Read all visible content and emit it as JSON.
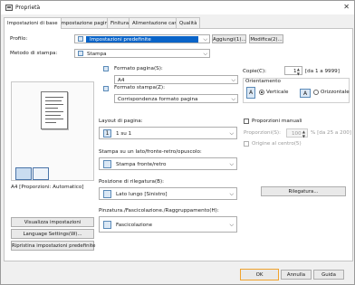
{
  "window": {
    "title": "Proprietà",
    "close_glyph": "✕"
  },
  "tabs": [
    {
      "label": "Impostazioni di base",
      "active": true
    },
    {
      "label": "Impostazione pagina"
    },
    {
      "label": "Finitura"
    },
    {
      "label": "Alimentazione carta"
    },
    {
      "label": "Qualità"
    }
  ],
  "profile": {
    "label": "Profilo:",
    "value": "Impostazioni predefinite",
    "add_label": "Aggiungi(1)...",
    "edit_label": "Modifica(2)..."
  },
  "output_method": {
    "label": "Metodo di stampa:",
    "value": "Stampa"
  },
  "paper_size": {
    "label": "Formato pagina(S):",
    "value": "A4"
  },
  "output_size": {
    "label": "Formato stampa(Z):",
    "value": "Corrispondenza formato pagina"
  },
  "copies": {
    "label": "Copie(C):",
    "value": "1",
    "range": "[da 1 a 9999]"
  },
  "orientation": {
    "label": "Orientamento",
    "portrait": "Verticale",
    "landscape": "Orizzontale"
  },
  "page_layout": {
    "label": "Layout di pagina:",
    "value": "1 su 1"
  },
  "manual_scaling": {
    "label": "Proporzioni manuali",
    "scaling_label": "Proporzioni(S):",
    "scaling_value": "100",
    "scaling_range": "% [da 25 a 200]",
    "origin_label": "Origine al centro(5)"
  },
  "duplex": {
    "label": "Stampa su un lato/fronte-retro/opuscolo:",
    "value": "Stampa fronte/retro"
  },
  "binding": {
    "label": "Posizione di rilegatura(B):",
    "value": "Lato lungo [Sinistro]",
    "button": "Rilegatura..."
  },
  "finishing": {
    "label": "Pinzatura./Fascicolazione./Raggruppamento(H):",
    "value": "Fascicolazione"
  },
  "preview": {
    "caption": "A4 [Proporzioni: Automatico]"
  },
  "left_buttons": {
    "view_settings": "Visualizza impostazioni",
    "language": "Language Settings(W)...",
    "restore": "Ripristina impostazioni predefinite"
  },
  "footer": {
    "ok": "OK",
    "cancel": "Annulla",
    "help": "Guida"
  },
  "colors": {
    "accent": "#0a64c8",
    "ok_highlight": "#f0a32e"
  }
}
